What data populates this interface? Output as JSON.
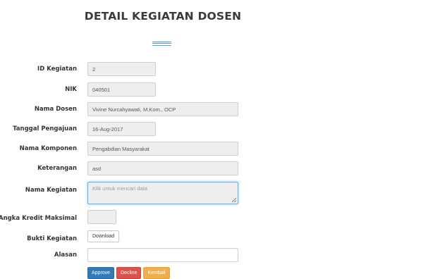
{
  "page": {
    "title": "DETAIL KEGIATAN DOSEN"
  },
  "form": {
    "id_kegiatan": {
      "label": "ID Kegiatan",
      "value": "2"
    },
    "nik": {
      "label": "NIK",
      "value": "040501"
    },
    "nama_dosen": {
      "label": "Nama Dosen",
      "value": "Vivine Nurcahyawati, M.Kom., OCP"
    },
    "tanggal_pengajuan": {
      "label": "Tanggal Pengajuan",
      "value": "16-Aug-2017"
    },
    "nama_komponen": {
      "label": "Nama Komponen",
      "value": "Pengabdian Masyarakat"
    },
    "keterangan": {
      "label": "Keterangan",
      "value": "asd"
    },
    "nama_kegiatan": {
      "label": "Nama Kegiatan",
      "placeholder": "Klik untuk mencari data"
    },
    "angka_kredit": {
      "label": "Angka Kredit Maksimal",
      "value": ""
    },
    "bukti_kegiatan": {
      "label": "Bukti Kegiatan",
      "button": "Download"
    },
    "alasan": {
      "label": "Alasan",
      "value": ""
    }
  },
  "actions": {
    "approve": "Approve",
    "decline": "Decline",
    "kembali": "Kembali"
  },
  "colors": {
    "approve": "#337ab7",
    "decline": "#d9534f",
    "kembali": "#f0ad4e",
    "accent": "#4d9fd6"
  }
}
